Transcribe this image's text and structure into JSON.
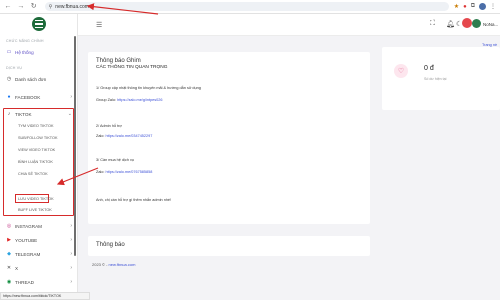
{
  "browser": {
    "url": "new.fbnua.com",
    "status_url": "https://new.fbnua.com/tiktok/TIKTOK"
  },
  "sidebar": {
    "section_main": "CHỨC NĂNG CHÍNH",
    "he_thong": "Hệ thống",
    "section_service": "DỊCH VỤ",
    "danh_sach_don": "Danh sách đơn",
    "facebook": "FACEBOOK",
    "tiktok": "TIKTOK",
    "tiktok_sub": [
      "TYM VIDEO TIKTOK",
      "SUB/FOLLOW TIKTOK",
      "VIEW VIDEO TIKTOK",
      "BÌNH LUẬN TIKTOK",
      "CHIA SẺ TIKTOK",
      "LƯU VIDEO TIKTOK",
      "BUFF LIVE TIKTOK"
    ],
    "instagram": "INSTAGRAM",
    "youtube": "YOUTUBE",
    "telegram": "TELEGRAM",
    "x": "X",
    "thread": "THREAD"
  },
  "header": {
    "badge": "",
    "username": "NoNa..."
  },
  "notice": {
    "title": "Thông báo Ghim",
    "heading": "CÁC THÔNG TIN QUAN TRỌNG",
    "line1": "1/ Group cập nhật thông tin khuyến mãi & hướng dẫn sử dụng",
    "line2_label": "Group Zalo: ",
    "line2_link": "https://zalo.me/g/intpes026",
    "line3_label": "2/ Admin hỗ trợ",
    "line4_label": "Zalo: ",
    "line4_link": "https://zalo.me/0347452297",
    "line5_label": "3/ Cần mua hệ dịch vụ",
    "line6_label": "Zalo: ",
    "line6_link": "https://zalo.me/0767585858",
    "line7": "Anh, chị cần hỗ trợ gì thêm nhắn admin nhé!"
  },
  "notice2": {
    "title": "Thông báo"
  },
  "balance": {
    "amount": "0 đ",
    "sub": "Số dư hiện tại"
  },
  "right_link": "Trang nề",
  "footer": {
    "prefix": "2023 © - ",
    "link": "new.fbnua.com"
  },
  "colors": {
    "accent": "#5b4cc4",
    "annotation": "#d62b2b",
    "link": "#3b4fd6"
  }
}
